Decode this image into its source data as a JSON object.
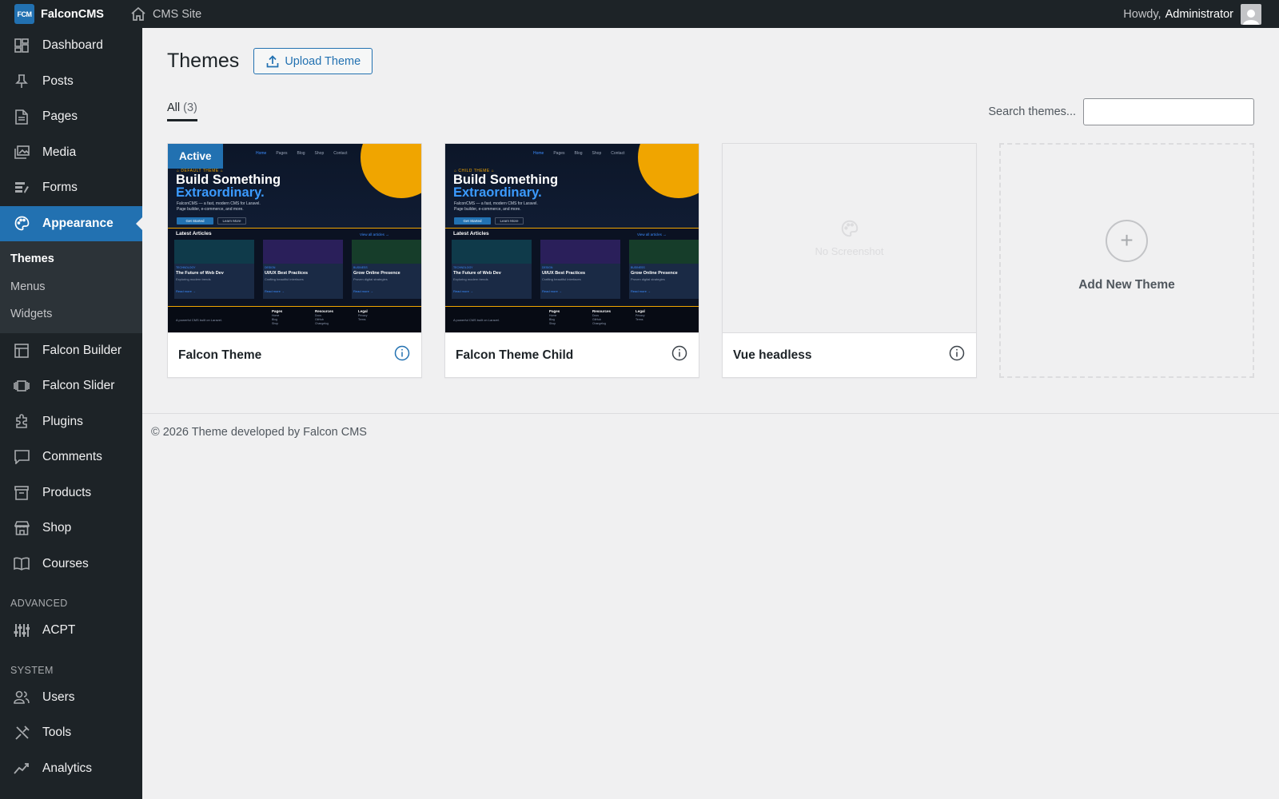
{
  "adminbar": {
    "logo_text": "FCM",
    "brand": "FalconCMS",
    "site_label": "CMS Site",
    "greeting": "Howdy,",
    "user": "Administrator"
  },
  "sidebar": {
    "items": [
      {
        "label": "Dashboard",
        "icon": "dashboard-icon"
      },
      {
        "label": "Posts",
        "icon": "pin-icon"
      },
      {
        "label": "Pages",
        "icon": "page-icon"
      },
      {
        "label": "Media",
        "icon": "media-icon"
      },
      {
        "label": "Forms",
        "icon": "forms-icon"
      },
      {
        "label": "Appearance",
        "icon": "palette-icon"
      }
    ],
    "submenu": [
      "Themes",
      "Menus",
      "Widgets"
    ],
    "items2": [
      {
        "label": "Falcon Builder",
        "icon": "builder-icon"
      },
      {
        "label": "Falcon Slider",
        "icon": "slider-icon"
      },
      {
        "label": "Plugins",
        "icon": "plugin-icon"
      },
      {
        "label": "Comments",
        "icon": "comment-icon"
      },
      {
        "label": "Products",
        "icon": "archive-icon"
      },
      {
        "label": "Shop",
        "icon": "store-icon"
      },
      {
        "label": "Courses",
        "icon": "book-icon"
      }
    ],
    "section_advanced": "ADVANCED",
    "advanced_items": [
      {
        "label": "ACPT",
        "icon": "sliders-icon"
      }
    ],
    "section_system": "SYSTEM",
    "system_items": [
      {
        "label": "Users",
        "icon": "users-icon"
      },
      {
        "label": "Tools",
        "icon": "tools-icon"
      },
      {
        "label": "Analytics",
        "icon": "chart-line-icon"
      }
    ]
  },
  "main": {
    "title": "Themes",
    "upload_label": "Upload Theme",
    "filter_label": "All",
    "filter_count": "(3)",
    "search_label": "Search themes...",
    "search_value": "",
    "themes": [
      {
        "name": "Falcon Theme",
        "active_badge": "Active"
      },
      {
        "name": "Falcon Theme Child"
      },
      {
        "name": "Vue headless",
        "no_screenshot": "No Screenshot"
      }
    ],
    "add_new_label": "Add New Theme",
    "footer": "© 2026 Theme developed by Falcon CMS"
  },
  "preview": {
    "nav": [
      "Home",
      "Pages",
      "Blog",
      "Shop",
      "Contact"
    ],
    "kicker1": "⌂ DEFAULT THEME ⌂",
    "kicker2": "⌂ CHILD THEME ⌂",
    "headline1": "Build Something",
    "headline2": "Extraordinary.",
    "desc1": "FalconCMS — a fast, modern CMS for Laravel.",
    "desc2": "Page builder, e-commerce, and more.",
    "btn_primary": "Get Started",
    "btn_secondary": "Learn More",
    "latest": "Latest Articles",
    "view_all": "View all articles →",
    "cards": [
      {
        "tag": "TECHNOLOGY",
        "title": "The Future of Web Dev",
        "sub": "Exploring modern trends",
        "color": "#0f3a4a"
      },
      {
        "tag": "DESIGN",
        "title": "UI/UX Best Practices",
        "sub": "Crafting beautiful interfaces",
        "color": "#2a1f5a"
      },
      {
        "tag": "BUSINESS",
        "title": "Grow Online Presence",
        "sub": "Proven digital strategies",
        "color": "#163d2a"
      }
    ],
    "read_more": "Read more →",
    "foot_tagline": "A powerful CMS built on Laravel.",
    "foot_cols": [
      {
        "h": "Pages",
        "l": [
          "Home",
          "Blog",
          "Shop"
        ]
      },
      {
        "h": "Resources",
        "l": [
          "Docs",
          "GitHub",
          "Changelog"
        ]
      },
      {
        "h": "Legal",
        "l": [
          "Privacy",
          "Terms"
        ]
      }
    ]
  },
  "colors": {
    "accent": "#2271b1",
    "adminbar": "#1d2327",
    "sun": "#f0a500"
  }
}
